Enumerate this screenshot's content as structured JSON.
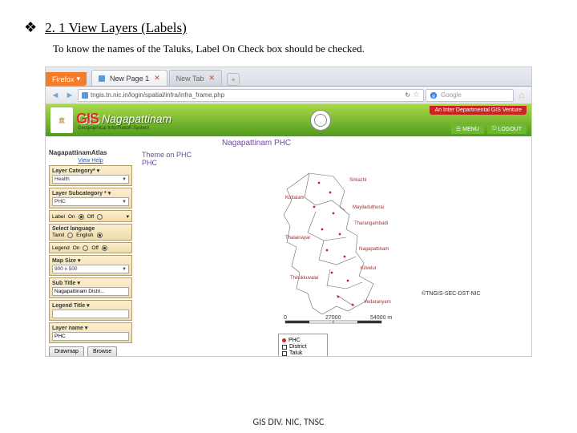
{
  "doc": {
    "bullet": "❖",
    "heading": "2. 1 View Layers (Labels)",
    "description": "To know the names of the Taluks, Label On Check box should be checked."
  },
  "browser": {
    "appButton": "Firefox",
    "tab1": "New Page 1",
    "tab2": "New Tab",
    "plus": "+",
    "url": "tngis.tn.nic.in/login/spatial/infra/infra_frame.php",
    "reloadIcon": "↻",
    "starIcon": "☆",
    "bookmarkIcon": "❘",
    "searchPlaceholder": "Google",
    "backIcon": "◄",
    "fwdIcon": "►",
    "homeIcon": "⌂",
    "dropIcon": "▾"
  },
  "banner": {
    "gis": "GIS",
    "district": "Nagapattinam",
    "subtitle": "Geographical Information System",
    "redPill": "An Inter Departmental GIS Venture",
    "menuBtn": "MENU",
    "logoutBtn": "LOGOUT",
    "menuIcon": "☰",
    "logoutIcon": "⎋"
  },
  "subTitle": "Nagapattinam PHC",
  "sidebar": {
    "title": "NagapattinamAtlas",
    "helpLink": "View Help",
    "layerCat": {
      "label": "Layer Category*",
      "value": "Health"
    },
    "layerSub": {
      "label": "Layer Subcategory *",
      "value": "PHC"
    },
    "labelRow": {
      "label": "Label",
      "on": "On",
      "off": "Off"
    },
    "selLang": {
      "label": "Select language",
      "opt1": "Tamil",
      "opt2": "English"
    },
    "legendRow": {
      "label": "Legend",
      "on": "On",
      "off": "Off"
    },
    "mapSize": {
      "label": "Map Size",
      "value": "900 x 500"
    },
    "subTitle": {
      "label": "Sub Title",
      "value": "Nagapattinam Distri..."
    },
    "legendTitle": {
      "label": "Legend Title",
      "value": ""
    },
    "layerName": {
      "label": "Layer name",
      "value": "PHC"
    },
    "btnDraw": "Drawmap",
    "btnBrowse": "Browse",
    "chev": "▾",
    "radio": "○",
    "radioOn": "●"
  },
  "map": {
    "themeLabel": "Theme on PHC",
    "themeValue": "PHC",
    "labels": [
      "Sirkazhi",
      "Thalainayar",
      "Kuttalam",
      "Mayiladuthurai",
      "Tharangambadi",
      "Nagapattinam",
      "Kilvelur",
      "Thirukkuvalai",
      "Vedaranyam"
    ],
    "scaleVals": [
      "0",
      "27000",
      "54000 m"
    ],
    "credit": "©TNGIS-SEC-DST-NIC"
  },
  "legend": {
    "phc": "PHC",
    "district": "District",
    "taluk": "Taluk"
  },
  "footer": "GIS DIV. NIC, TNSC"
}
